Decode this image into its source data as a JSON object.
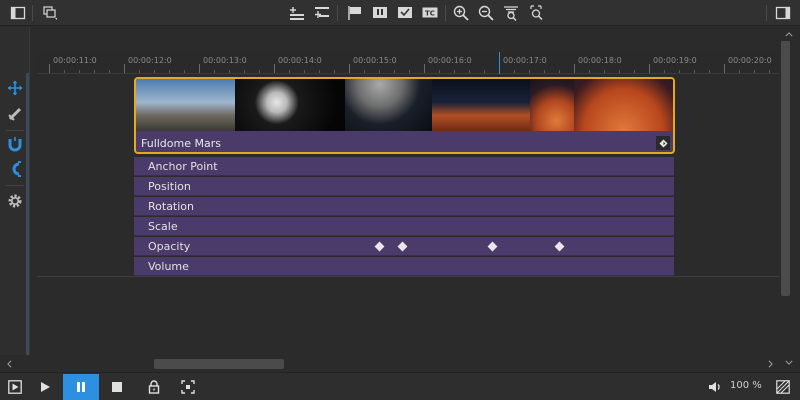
{
  "toolbar": {
    "left": [
      "panel-left-icon",
      "layers-icon"
    ],
    "center": [
      "insert-track-above-icon",
      "insert-track-below-icon",
      "flag-icon",
      "marker-pause-icon",
      "marker-check-icon",
      "timecode-icon",
      "zoom-in-icon",
      "zoom-out-icon",
      "zoom-fit-icon",
      "zoom-reset-icon"
    ],
    "timecode_badge": "TC",
    "right": [
      "panel-right-icon"
    ]
  },
  "left_tools": [
    "move-icon",
    "razor-icon",
    "magnet-icon",
    "snap-icon",
    "settings-icon"
  ],
  "ruler": {
    "labels": [
      "00:00:11:0",
      "00:00:12:0",
      "00:00:13:0",
      "00:00:14:0",
      "00:00:15:0",
      "00:00:16:0",
      "00:00:17:0",
      "00:00:18:0",
      "00:00:19:0",
      "00:00:20:0"
    ]
  },
  "clip": {
    "name": "Fulldome Mars",
    "thumbnails": [
      "rocket-launch",
      "astronaut",
      "moon",
      "red-planet-horizon",
      "red-planet",
      "red-planet-2"
    ]
  },
  "properties": [
    {
      "label": "Anchor Point",
      "keyframes": []
    },
    {
      "label": "Position",
      "keyframes": []
    },
    {
      "label": "Rotation",
      "keyframes": []
    },
    {
      "label": "Scale",
      "keyframes": []
    },
    {
      "label": "Opacity",
      "keyframes": [
        15.4,
        15.7,
        16.9,
        17.8
      ]
    },
    {
      "label": "Volume",
      "keyframes": []
    }
  ],
  "transport": {
    "buttons": [
      "stop-to-start-icon",
      "play-icon",
      "pause-icon",
      "stop-icon",
      "lock-icon",
      "fit-icon"
    ],
    "volume_icon": "volume-icon",
    "zoom": "100 %",
    "corner_icon": "graph-icon"
  },
  "colors": {
    "accent": "#2c8fe0",
    "clip": "#4a3b6b",
    "clip_border": "#e5a823",
    "playhead": "#2f8fd8"
  }
}
